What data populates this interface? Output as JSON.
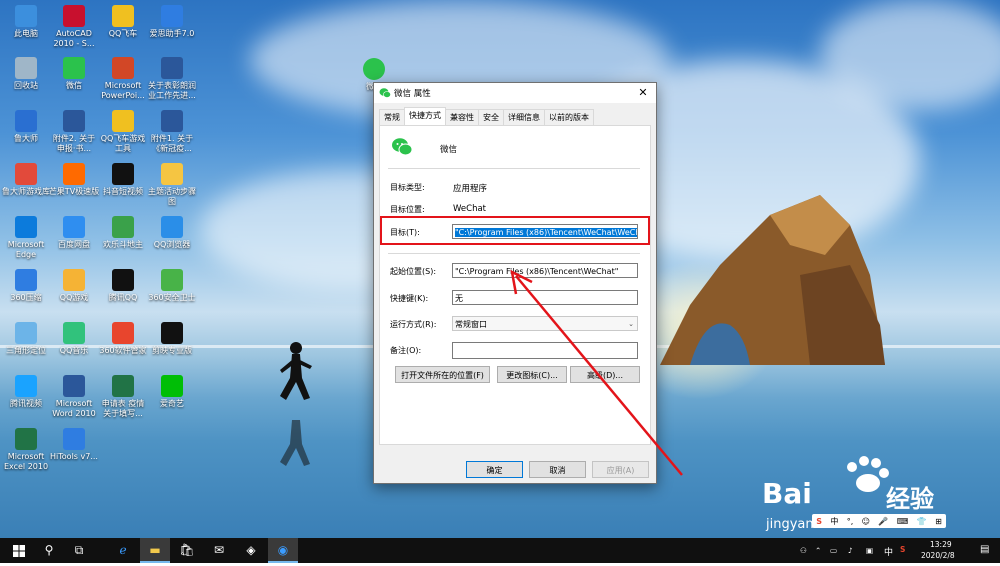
{
  "desktop": {
    "icons": [
      {
        "label": "此电脑",
        "color": "#3c8fdd"
      },
      {
        "label": "AutoCAD 2010 - S...",
        "color": "#c8102e"
      },
      {
        "label": "QQ飞车",
        "color": "#f0c020"
      },
      {
        "label": "爱思助手7.0",
        "color": "#2f7de1"
      },
      {
        "label": "回收站",
        "color": "#9fb6c8"
      },
      {
        "label": "微信",
        "color": "#2bc24c"
      },
      {
        "label": "Microsoft PowerPoi...",
        "color": "#d24726"
      },
      {
        "label": "关于表彰朗润 业工作先进...",
        "color": "#2b579a"
      },
      {
        "label": "鲁大师",
        "color": "#2a6fd1"
      },
      {
        "label": "附件2. 关于 申报·书...",
        "color": "#2b579a"
      },
      {
        "label": "QQ飞车游戏 工具",
        "color": "#f0c020"
      },
      {
        "label": "附件1. 关于 《新冠疫...",
        "color": "#2b579a"
      },
      {
        "label": "鲁大师游戏库",
        "color": "#e24a3b"
      },
      {
        "label": "芒果TV极速版",
        "color": "#ff6a00"
      },
      {
        "label": "抖音短视频",
        "color": "#111111"
      },
      {
        "label": "主题活动步骤图",
        "color": "#f5c542"
      },
      {
        "label": "Microsoft Edge",
        "color": "#0c7bdc"
      },
      {
        "label": "百度网盘",
        "color": "#2f8ef0"
      },
      {
        "label": "欢乐斗地主",
        "color": "#3aa14a"
      },
      {
        "label": "QQ浏览器",
        "color": "#2a8ee8"
      },
      {
        "label": "360压缩",
        "color": "#2f7de1"
      },
      {
        "label": "QQ游戏",
        "color": "#f5b335"
      },
      {
        "label": "腾讯QQ",
        "color": "#111111"
      },
      {
        "label": "360安全卫士",
        "color": "#48b348"
      },
      {
        "label": "三角形定位",
        "color": "#6cb4e8"
      },
      {
        "label": "QQ音乐",
        "color": "#31c27c"
      },
      {
        "label": "360软件管家",
        "color": "#e8452d"
      },
      {
        "label": "剪映专业版",
        "color": "#111111"
      },
      {
        "label": "腾讯视频",
        "color": "#1aa3ff"
      },
      {
        "label": "Microsoft Word 2010",
        "color": "#2b579a"
      },
      {
        "label": "申请表 疫情 关于填写...",
        "color": "#217346"
      },
      {
        "label": "爱奇艺",
        "color": "#00be06"
      },
      {
        "label": "Microsoft Excel 2010",
        "color": "#217346"
      },
      {
        "label": "HiTools v7...",
        "color": "#2f7de1"
      }
    ],
    "floating_icon": {
      "label": "微...",
      "color": "#2bc24c"
    }
  },
  "dialog": {
    "title": "微信 属性",
    "close": "✕",
    "tabs": [
      "常规",
      "快捷方式",
      "兼容性",
      "安全",
      "详细信息",
      "以前的版本"
    ],
    "active_tab": "快捷方式",
    "app_name": "微信",
    "target_type_label": "目标类型:",
    "target_type_value": "应用程序",
    "target_location_label": "目标位置:",
    "target_location_value": "WeChat",
    "target_label": "目标(T):",
    "target_value": "\"C:\\Program Files (x86)\\Tencent\\WeChat\\WeChat",
    "start_in_label": "起始位置(S):",
    "start_in_value": "\"C:\\Program Files (x86)\\Tencent\\WeChat\"",
    "shortcut_key_label": "快捷键(K):",
    "shortcut_key_value": "无",
    "run_label": "运行方式(R):",
    "run_value": "常规窗口",
    "comment_label": "备注(O):",
    "comment_value": "",
    "open_location_button": "打开文件所在的位置(F)",
    "change_icon_button": "更改图标(C)...",
    "advanced_button": "高级(D)...",
    "ok_button": "确定",
    "cancel_button": "取消",
    "apply_button": "应用(A)"
  },
  "taskbar": {
    "time": "13:29",
    "date": "2020/2/8",
    "ime": "中",
    "ime_bar_items": [
      "S",
      "中",
      "°,",
      "☺",
      "🎤",
      "⌨",
      "👕",
      "⊞"
    ]
  },
  "watermark": {
    "brand": "Bai",
    "brand_cn": "经验",
    "url": "jingyan.baidu.com"
  },
  "colors": {
    "accent": "#0078d7",
    "highlight": "#e3141a",
    "taskbar": "#101010"
  }
}
